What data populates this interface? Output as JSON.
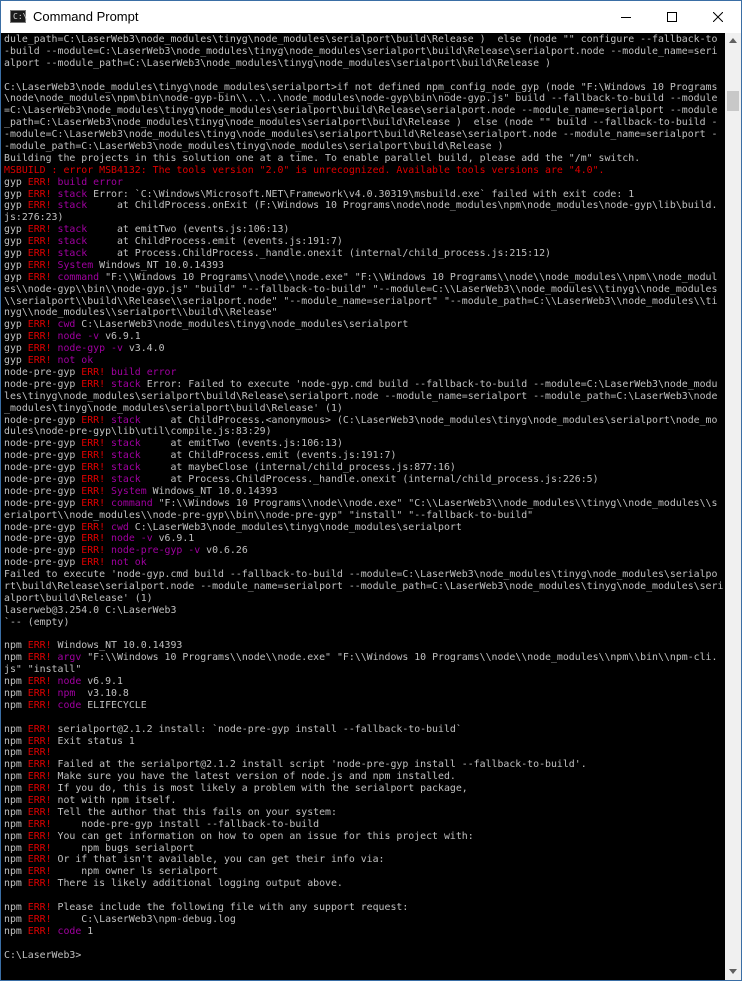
{
  "window": {
    "title": "Command Prompt",
    "icon_text": "C:\\"
  },
  "colors": {
    "default_text": "#c0c0c0",
    "error_text": "#e00000",
    "magenta_text": "#a000a0",
    "background": "#000000"
  },
  "lines": [
    [
      {
        "t": "dule_path=C:\\LaserWeb3\\node_modules\\tinyg\\node_modules\\serialport\\build\\Release )  else (node \"\" configure --fallback-to"
      }
    ],
    [
      {
        "t": "-build --module=C:\\LaserWeb3\\node_modules\\tinyg\\node_modules\\serialport\\build\\Release\\serialport.node --module_name=seri"
      }
    ],
    [
      {
        "t": "alport --module_path=C:\\LaserWeb3\\node_modules\\tinyg\\node_modules\\serialport\\build\\Release )"
      }
    ],
    [
      {
        "t": ""
      }
    ],
    [
      {
        "t": "C:\\LaserWeb3\\node_modules\\tinyg\\node_modules\\serialport>if not defined npm_config_node_gyp (node \"F:\\Windows 10 Programs"
      }
    ],
    [
      {
        "t": "\\node\\node_modules\\npm\\bin\\node-gyp-bin\\\\..\\..\\node_modules\\node-gyp\\bin\\node-gyp.js\" build --fallback-to-build --module"
      }
    ],
    [
      {
        "t": "=C:\\LaserWeb3\\node_modules\\tinyg\\node_modules\\serialport\\build\\Release\\serialport.node --module_name=serialport --module"
      }
    ],
    [
      {
        "t": "_path=C:\\LaserWeb3\\node_modules\\tinyg\\node_modules\\serialport\\build\\Release )  else (node \"\" build --fallback-to-build -"
      }
    ],
    [
      {
        "t": "-module=C:\\LaserWeb3\\node_modules\\tinyg\\node_modules\\serialport\\build\\Release\\serialport.node --module_name=serialport -"
      }
    ],
    [
      {
        "t": "-module_path=C:\\LaserWeb3\\node_modules\\tinyg\\node_modules\\serialport\\build\\Release )"
      }
    ],
    [
      {
        "t": "Building the projects in this solution one at a time. To enable parallel build, please add the \"/m\" switch."
      }
    ],
    [
      {
        "t": "MSBUILD : error MSB4132: The tools version \"2.0\" is unrecognized. Available tools versions are \"4.0\".",
        "c": "r"
      }
    ],
    [
      {
        "t": "gyp "
      },
      {
        "t": "ERR!",
        "c": "r"
      },
      {
        "t": " build error",
        "c": "m"
      }
    ],
    [
      {
        "t": "gyp "
      },
      {
        "t": "ERR!",
        "c": "r"
      },
      {
        "t": " stack",
        "c": "m"
      },
      {
        "t": " Error: `C:\\Windows\\Microsoft.NET\\Framework\\v4.0.30319\\msbuild.exe` failed with exit code: 1"
      }
    ],
    [
      {
        "t": "gyp "
      },
      {
        "t": "ERR!",
        "c": "r"
      },
      {
        "t": " stack",
        "c": "m"
      },
      {
        "t": "     at ChildProcess.onExit (F:\\Windows 10 Programs\\node\\node_modules\\npm\\node_modules\\node-gyp\\lib\\build."
      }
    ],
    [
      {
        "t": "js:276:23)"
      }
    ],
    [
      {
        "t": "gyp "
      },
      {
        "t": "ERR!",
        "c": "r"
      },
      {
        "t": " stack",
        "c": "m"
      },
      {
        "t": "     at emitTwo (events.js:106:13)"
      }
    ],
    [
      {
        "t": "gyp "
      },
      {
        "t": "ERR!",
        "c": "r"
      },
      {
        "t": " stack",
        "c": "m"
      },
      {
        "t": "     at ChildProcess.emit (events.js:191:7)"
      }
    ],
    [
      {
        "t": "gyp "
      },
      {
        "t": "ERR!",
        "c": "r"
      },
      {
        "t": " stack",
        "c": "m"
      },
      {
        "t": "     at Process.ChildProcess._handle.onexit (internal/child_process.js:215:12)"
      }
    ],
    [
      {
        "t": "gyp "
      },
      {
        "t": "ERR!",
        "c": "r"
      },
      {
        "t": " System",
        "c": "m"
      },
      {
        "t": " Windows_NT 10.0.14393"
      }
    ],
    [
      {
        "t": "gyp "
      },
      {
        "t": "ERR!",
        "c": "r"
      },
      {
        "t": " command",
        "c": "m"
      },
      {
        "t": " \"F:\\\\Windows 10 Programs\\\\node\\\\node.exe\" \"F:\\\\Windows 10 Programs\\\\node\\\\node_modules\\\\npm\\\\node_modul"
      }
    ],
    [
      {
        "t": "es\\\\node-gyp\\\\bin\\\\node-gyp.js\" \"build\" \"--fallback-to-build\" \"--module=C:\\\\LaserWeb3\\\\node_modules\\\\tinyg\\\\node_modules"
      }
    ],
    [
      {
        "t": "\\\\serialport\\\\build\\\\Release\\\\serialport.node\" \"--module_name=serialport\" \"--module_path=C:\\\\LaserWeb3\\\\node_modules\\\\ti"
      }
    ],
    [
      {
        "t": "nyg\\\\node_modules\\\\serialport\\\\build\\\\Release\""
      }
    ],
    [
      {
        "t": "gyp "
      },
      {
        "t": "ERR!",
        "c": "r"
      },
      {
        "t": " cwd",
        "c": "m"
      },
      {
        "t": " C:\\LaserWeb3\\node_modules\\tinyg\\node_modules\\serialport"
      }
    ],
    [
      {
        "t": "gyp "
      },
      {
        "t": "ERR!",
        "c": "r"
      },
      {
        "t": " node -v",
        "c": "m"
      },
      {
        "t": " v6.9.1"
      }
    ],
    [
      {
        "t": "gyp "
      },
      {
        "t": "ERR!",
        "c": "r"
      },
      {
        "t": " node-gyp -v",
        "c": "m"
      },
      {
        "t": " v3.4.0"
      }
    ],
    [
      {
        "t": "gyp "
      },
      {
        "t": "ERR!",
        "c": "r"
      },
      {
        "t": " not ok",
        "c": "m"
      }
    ],
    [
      {
        "t": "node-pre-gyp "
      },
      {
        "t": "ERR!",
        "c": "r"
      },
      {
        "t": " build error",
        "c": "m"
      }
    ],
    [
      {
        "t": "node-pre-gyp "
      },
      {
        "t": "ERR!",
        "c": "r"
      },
      {
        "t": " stack",
        "c": "m"
      },
      {
        "t": " Error: Failed to execute 'node-gyp.cmd build --fallback-to-build --module=C:\\LaserWeb3\\node_modu"
      }
    ],
    [
      {
        "t": "les\\tinyg\\node_modules\\serialport\\build\\Release\\serialport.node --module_name=serialport --module_path=C:\\LaserWeb3\\node"
      }
    ],
    [
      {
        "t": "_modules\\tinyg\\node_modules\\serialport\\build\\Release' (1)"
      }
    ],
    [
      {
        "t": "node-pre-gyp "
      },
      {
        "t": "ERR!",
        "c": "r"
      },
      {
        "t": " stack",
        "c": "m"
      },
      {
        "t": "     at ChildProcess.<anonymous> (C:\\LaserWeb3\\node_modules\\tinyg\\node_modules\\serialport\\node_mo"
      }
    ],
    [
      {
        "t": "dules\\node-pre-gyp\\lib\\util\\compile.js:83:29)"
      }
    ],
    [
      {
        "t": "node-pre-gyp "
      },
      {
        "t": "ERR!",
        "c": "r"
      },
      {
        "t": " stack",
        "c": "m"
      },
      {
        "t": "     at emitTwo (events.js:106:13)"
      }
    ],
    [
      {
        "t": "node-pre-gyp "
      },
      {
        "t": "ERR!",
        "c": "r"
      },
      {
        "t": " stack",
        "c": "m"
      },
      {
        "t": "     at ChildProcess.emit (events.js:191:7)"
      }
    ],
    [
      {
        "t": "node-pre-gyp "
      },
      {
        "t": "ERR!",
        "c": "r"
      },
      {
        "t": " stack",
        "c": "m"
      },
      {
        "t": "     at maybeClose (internal/child_process.js:877:16)"
      }
    ],
    [
      {
        "t": "node-pre-gyp "
      },
      {
        "t": "ERR!",
        "c": "r"
      },
      {
        "t": " stack",
        "c": "m"
      },
      {
        "t": "     at Process.ChildProcess._handle.onexit (internal/child_process.js:226:5)"
      }
    ],
    [
      {
        "t": "node-pre-gyp "
      },
      {
        "t": "ERR!",
        "c": "r"
      },
      {
        "t": " System",
        "c": "m"
      },
      {
        "t": " Windows_NT 10.0.14393"
      }
    ],
    [
      {
        "t": "node-pre-gyp "
      },
      {
        "t": "ERR!",
        "c": "r"
      },
      {
        "t": " command",
        "c": "m"
      },
      {
        "t": " \"F:\\\\Windows 10 Programs\\\\node\\\\node.exe\" \"C:\\\\LaserWeb3\\\\node_modules\\\\tinyg\\\\node_modules\\\\s"
      }
    ],
    [
      {
        "t": "erialport\\\\node_modules\\\\node-pre-gyp\\\\bin\\\\node-pre-gyp\" \"install\" \"--fallback-to-build\""
      }
    ],
    [
      {
        "t": "node-pre-gyp "
      },
      {
        "t": "ERR!",
        "c": "r"
      },
      {
        "t": " cwd",
        "c": "m"
      },
      {
        "t": " C:\\LaserWeb3\\node_modules\\tinyg\\node_modules\\serialport"
      }
    ],
    [
      {
        "t": "node-pre-gyp "
      },
      {
        "t": "ERR!",
        "c": "r"
      },
      {
        "t": " node -v",
        "c": "m"
      },
      {
        "t": " v6.9.1"
      }
    ],
    [
      {
        "t": "node-pre-gyp "
      },
      {
        "t": "ERR!",
        "c": "r"
      },
      {
        "t": " node-pre-gyp -v",
        "c": "m"
      },
      {
        "t": " v0.6.26"
      }
    ],
    [
      {
        "t": "node-pre-gyp "
      },
      {
        "t": "ERR!",
        "c": "r"
      },
      {
        "t": " not ok",
        "c": "m"
      }
    ],
    [
      {
        "t": "Failed to execute 'node-gyp.cmd build --fallback-to-build --module=C:\\LaserWeb3\\node_modules\\tinyg\\node_modules\\serialpo"
      }
    ],
    [
      {
        "t": "rt\\build\\Release\\serialport.node --module_name=serialport --module_path=C:\\LaserWeb3\\node_modules\\tinyg\\node_modules\\seri"
      }
    ],
    [
      {
        "t": "alport\\build\\Release' (1)"
      }
    ],
    [
      {
        "t": "laserweb@3.254.0 C:\\LaserWeb3"
      }
    ],
    [
      {
        "t": "`-- (empty)"
      }
    ],
    [
      {
        "t": ""
      }
    ],
    [
      {
        "t": "npm "
      },
      {
        "t": "ERR!",
        "c": "r"
      },
      {
        "t": " Windows_NT 10.0.14393"
      }
    ],
    [
      {
        "t": "npm "
      },
      {
        "t": "ERR!",
        "c": "r"
      },
      {
        "t": " argv",
        "c": "m"
      },
      {
        "t": " \"F:\\\\Windows 10 Programs\\\\node\\\\node.exe\" \"F:\\\\Windows 10 Programs\\\\node\\\\node_modules\\\\npm\\\\bin\\\\npm-cli."
      }
    ],
    [
      {
        "t": "js\" \"install\""
      }
    ],
    [
      {
        "t": "npm "
      },
      {
        "t": "ERR!",
        "c": "r"
      },
      {
        "t": " node",
        "c": "m"
      },
      {
        "t": " v6.9.1"
      }
    ],
    [
      {
        "t": "npm "
      },
      {
        "t": "ERR!",
        "c": "r"
      },
      {
        "t": " npm ",
        "c": "m"
      },
      {
        "t": " v3.10.8"
      }
    ],
    [
      {
        "t": "npm "
      },
      {
        "t": "ERR!",
        "c": "r"
      },
      {
        "t": " code",
        "c": "m"
      },
      {
        "t": " ELIFECYCLE"
      }
    ],
    [
      {
        "t": ""
      }
    ],
    [
      {
        "t": "npm "
      },
      {
        "t": "ERR!",
        "c": "r"
      },
      {
        "t": " serialport@2.1.2 install: `node-pre-gyp install --fallback-to-build`"
      }
    ],
    [
      {
        "t": "npm "
      },
      {
        "t": "ERR!",
        "c": "r"
      },
      {
        "t": " Exit status 1"
      }
    ],
    [
      {
        "t": "npm "
      },
      {
        "t": "ERR!",
        "c": "r"
      }
    ],
    [
      {
        "t": "npm "
      },
      {
        "t": "ERR!",
        "c": "r"
      },
      {
        "t": " Failed at the serialport@2.1.2 install script 'node-pre-gyp install --fallback-to-build'."
      }
    ],
    [
      {
        "t": "npm "
      },
      {
        "t": "ERR!",
        "c": "r"
      },
      {
        "t": " Make sure you have the latest version of node.js and npm installed."
      }
    ],
    [
      {
        "t": "npm "
      },
      {
        "t": "ERR!",
        "c": "r"
      },
      {
        "t": " If you do, this is most likely a problem with the serialport package,"
      }
    ],
    [
      {
        "t": "npm "
      },
      {
        "t": "ERR!",
        "c": "r"
      },
      {
        "t": " not with npm itself."
      }
    ],
    [
      {
        "t": "npm "
      },
      {
        "t": "ERR!",
        "c": "r"
      },
      {
        "t": " Tell the author that this fails on your system:"
      }
    ],
    [
      {
        "t": "npm "
      },
      {
        "t": "ERR!",
        "c": "r"
      },
      {
        "t": "     node-pre-gyp install --fallback-to-build"
      }
    ],
    [
      {
        "t": "npm "
      },
      {
        "t": "ERR!",
        "c": "r"
      },
      {
        "t": " You can get information on how to open an issue for this project with:"
      }
    ],
    [
      {
        "t": "npm "
      },
      {
        "t": "ERR!",
        "c": "r"
      },
      {
        "t": "     npm bugs serialport"
      }
    ],
    [
      {
        "t": "npm "
      },
      {
        "t": "ERR!",
        "c": "r"
      },
      {
        "t": " Or if that isn't available, you can get their info via:"
      }
    ],
    [
      {
        "t": "npm "
      },
      {
        "t": "ERR!",
        "c": "r"
      },
      {
        "t": "     npm owner ls serialport"
      }
    ],
    [
      {
        "t": "npm "
      },
      {
        "t": "ERR!",
        "c": "r"
      },
      {
        "t": " There is likely additional logging output above."
      }
    ],
    [
      {
        "t": ""
      }
    ],
    [
      {
        "t": "npm "
      },
      {
        "t": "ERR!",
        "c": "r"
      },
      {
        "t": " Please include the following file with any support request:"
      }
    ],
    [
      {
        "t": "npm "
      },
      {
        "t": "ERR!",
        "c": "r"
      },
      {
        "t": "     C:\\LaserWeb3\\npm-debug.log"
      }
    ],
    [
      {
        "t": "npm "
      },
      {
        "t": "ERR!",
        "c": "r"
      },
      {
        "t": " code",
        "c": "m"
      },
      {
        "t": " 1"
      }
    ],
    [
      {
        "t": ""
      }
    ],
    [
      {
        "t": "C:\\LaserWeb3>"
      }
    ]
  ]
}
